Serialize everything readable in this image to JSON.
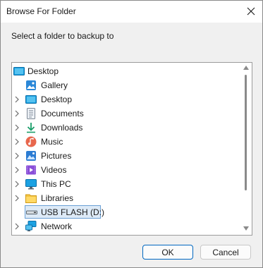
{
  "window": {
    "title": "Browse For Folder"
  },
  "instruction": "Select a folder to backup to",
  "tree": {
    "root": {
      "label": "Desktop",
      "icon": "desktop-icon"
    },
    "items": [
      {
        "label": "Gallery",
        "icon": "gallery-icon",
        "expandable": false
      },
      {
        "label": "Desktop",
        "icon": "desktop-icon",
        "expandable": true
      },
      {
        "label": "Documents",
        "icon": "documents-icon",
        "expandable": true
      },
      {
        "label": "Downloads",
        "icon": "downloads-icon",
        "expandable": true
      },
      {
        "label": "Music",
        "icon": "music-icon",
        "expandable": true
      },
      {
        "label": "Pictures",
        "icon": "pictures-icon",
        "expandable": true
      },
      {
        "label": "Videos",
        "icon": "videos-icon",
        "expandable": true
      },
      {
        "label": "This PC",
        "icon": "this-pc-icon",
        "expandable": true
      },
      {
        "label": "Libraries",
        "icon": "libraries-icon",
        "expandable": true
      },
      {
        "label": "USB FLASH (D:)",
        "icon": "usb-drive-icon",
        "expandable": false,
        "selected": true
      },
      {
        "label": "Network",
        "icon": "network-icon",
        "expandable": true
      }
    ]
  },
  "buttons": {
    "ok": "OK",
    "cancel": "Cancel"
  },
  "colors": {
    "selection": "#ddeaf7",
    "selection_border": "#6a9fd4",
    "accent": "#0067c0"
  }
}
